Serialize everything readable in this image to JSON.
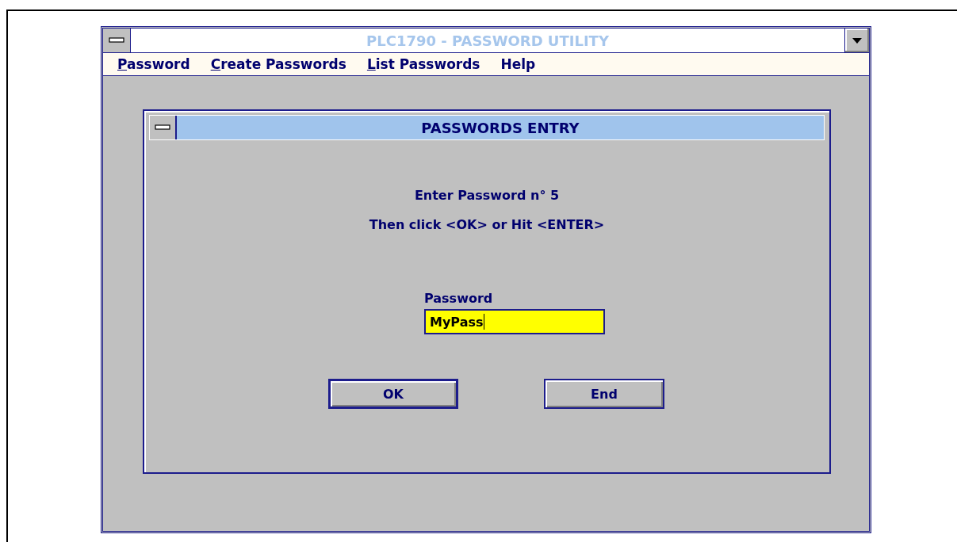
{
  "window": {
    "title": "PLC1790 - PASSWORD UTILITY"
  },
  "menu": [
    {
      "label": "Password",
      "mnemonic": true
    },
    {
      "label": "Create Passwords",
      "mnemonic": true
    },
    {
      "label": "List Passwords",
      "mnemonic": true
    },
    {
      "label": "Help",
      "mnemonic": false
    }
  ],
  "dialog": {
    "title": "PASSWORDS ENTRY",
    "prompt": "Enter Password n° 5",
    "hint": "Then click <OK> or Hit <ENTER>",
    "field": {
      "label": "Password",
      "value": "MyPass",
      "focused": true
    },
    "buttons": [
      {
        "label": "OK",
        "default": true
      },
      {
        "label": "End",
        "default": false
      }
    ]
  }
}
